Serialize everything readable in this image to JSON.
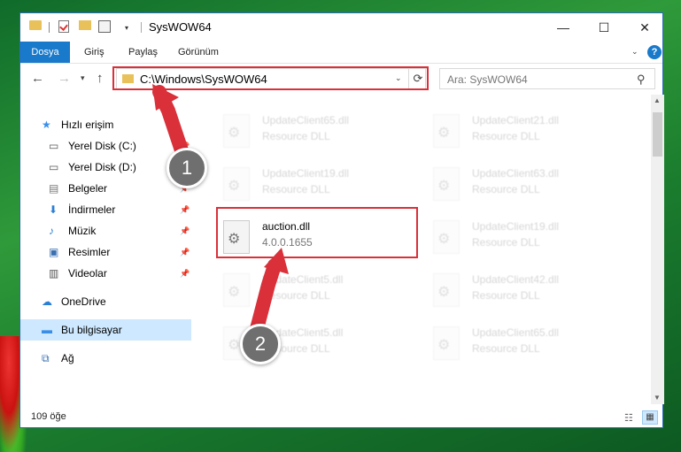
{
  "window": {
    "title": "SysWOW64"
  },
  "controls": {
    "minimize": "—",
    "maximize": "☐",
    "close": "✕"
  },
  "ribbon": {
    "tabs": [
      "Dosya",
      "Giriş",
      "Paylaş",
      "Görünüm"
    ],
    "help": "?"
  },
  "address": {
    "path": "C:\\Windows\\SysWOW64"
  },
  "search": {
    "placeholder": "Ara: SysWOW64"
  },
  "sidebar": {
    "items": [
      {
        "label": "Hızlı erişim",
        "icon": "star-icon",
        "pinned": false
      },
      {
        "label": "Yerel Disk (C:)",
        "icon": "drive-icon",
        "pinned": true
      },
      {
        "label": "Yerel Disk (D:)",
        "icon": "drive-icon",
        "pinned": false
      },
      {
        "label": "Belgeler",
        "icon": "documents-icon",
        "pinned": true
      },
      {
        "label": "İndirmeler",
        "icon": "download-icon",
        "pinned": true
      },
      {
        "label": "Müzik",
        "icon": "music-icon",
        "pinned": true
      },
      {
        "label": "Resimler",
        "icon": "pictures-icon",
        "pinned": true
      },
      {
        "label": "Videolar",
        "icon": "videos-icon",
        "pinned": true
      },
      {
        "label": "OneDrive",
        "icon": "cloud-icon",
        "pinned": false
      },
      {
        "label": "Bu bilgisayar",
        "icon": "computer-icon",
        "pinned": false,
        "selected": true
      },
      {
        "label": "Ağ",
        "icon": "network-icon",
        "pinned": false
      }
    ]
  },
  "files": [
    {
      "name": "UpdateClient65.dll",
      "sub": "Resource DLL",
      "faded": true
    },
    {
      "name": "UpdateClient21.dll",
      "sub": "Resource DLL",
      "faded": true
    },
    {
      "name": "UpdateClient19.dll",
      "sub": "Resource DLL",
      "faded": true
    },
    {
      "name": "UpdateClient63.dll",
      "sub": "Resource DLL",
      "faded": true
    },
    {
      "name": "auction.dll",
      "sub": "4.0.0.1655",
      "faded": false
    },
    {
      "name": "UpdateClient19.dll",
      "sub": "Resource DLL",
      "faded": true
    },
    {
      "name": "UpdateClient5.dll",
      "sub": "Resource DLL",
      "faded": true
    },
    {
      "name": "UpdateClient42.dll",
      "sub": "Resource DLL",
      "faded": true
    },
    {
      "name": "UpdateClient5.dll",
      "sub": "Resource DLL",
      "faded": true
    },
    {
      "name": "UpdateClient65.dll",
      "sub": "Resource DLL",
      "faded": true
    }
  ],
  "status": {
    "count": "109 öğe"
  },
  "annotations": {
    "step1": "1",
    "step2": "2",
    "color": "#d9303a"
  }
}
